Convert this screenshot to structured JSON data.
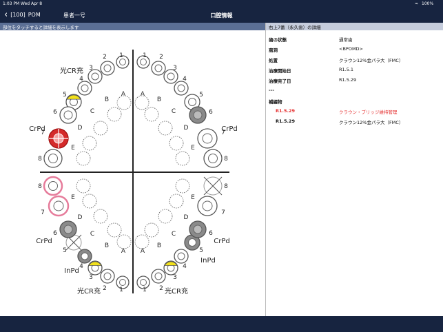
{
  "status_bar": {
    "time": "1:03 PM",
    "date": "Wed Apr 8",
    "battery": "100%"
  },
  "nav": {
    "back_label": "[100]",
    "app": "POM",
    "patient": "患者一号",
    "title": "口腔情報"
  },
  "chart_panel": {
    "hint": "部位をタッチすると詳細を表示します"
  },
  "detail_panel": {
    "title": "右上7番（永久歯）の詳細",
    "rows": [
      {
        "label": "歯の状態",
        "value": "通常歯"
      },
      {
        "label": "窩洞",
        "value": "<BPOMD>"
      },
      {
        "label": "処置",
        "value": "クラウン12%金パラ大（FMC）"
      },
      {
        "label": "治療開始日",
        "value": "R1.5.1"
      },
      {
        "label": "治療完了日",
        "value": "R1.5.29"
      },
      {
        "label": "---",
        "value": ""
      },
      {
        "label": "補綴物",
        "value": ""
      }
    ],
    "records": [
      {
        "date": "R1.5.29",
        "text": "クラウン・ブリッジ維持管理",
        "highlight": true
      },
      {
        "date": "R1.5.29",
        "text": "クラウン12%金パラ大（FMC）",
        "highlight": false
      }
    ]
  },
  "dental_chart": {
    "labels": {
      "ul": {
        "t1": "1",
        "t2": "2",
        "t3": "3",
        "t4": "4",
        "t5": "5",
        "t6": "6",
        "t7": "7",
        "t8": "8",
        "a": "A",
        "b": "B",
        "c": "C",
        "d": "D",
        "e": "E",
        "cr": "光CR充",
        "crpd": "CrPd"
      },
      "ur": {
        "t1": "1",
        "t2": "2",
        "t3": "3",
        "t4": "4",
        "t5": "5",
        "t6": "6",
        "t7": "7",
        "t8": "8",
        "a": "A",
        "b": "B",
        "c": "C",
        "d": "D",
        "e": "E",
        "crpd": "CrPd"
      },
      "ll": {
        "t1": "1",
        "t2": "2",
        "t3": "3",
        "t4": "4",
        "t5": "5",
        "t6": "6",
        "t7": "7",
        "t8": "8",
        "a": "A",
        "b": "B",
        "c": "C",
        "d": "D",
        "e": "E",
        "cr": "光CR充",
        "crpd": "CrPd",
        "inpd": "InPd"
      },
      "lr": {
        "t1": "1",
        "t2": "2",
        "t3": "3",
        "t4": "4",
        "t5": "5",
        "t6": "6",
        "t7": "7",
        "t8": "8",
        "a": "A",
        "b": "B",
        "c": "C",
        "d": "D",
        "e": "E",
        "cr": "光CR充",
        "crpd": "CrPd",
        "inpd": "InPd"
      }
    },
    "colors": {
      "selected": "#d42a2a",
      "crown": "#8a8a8a",
      "resin": "#f2e11a",
      "highlight_ring": "#e67c9b"
    }
  }
}
